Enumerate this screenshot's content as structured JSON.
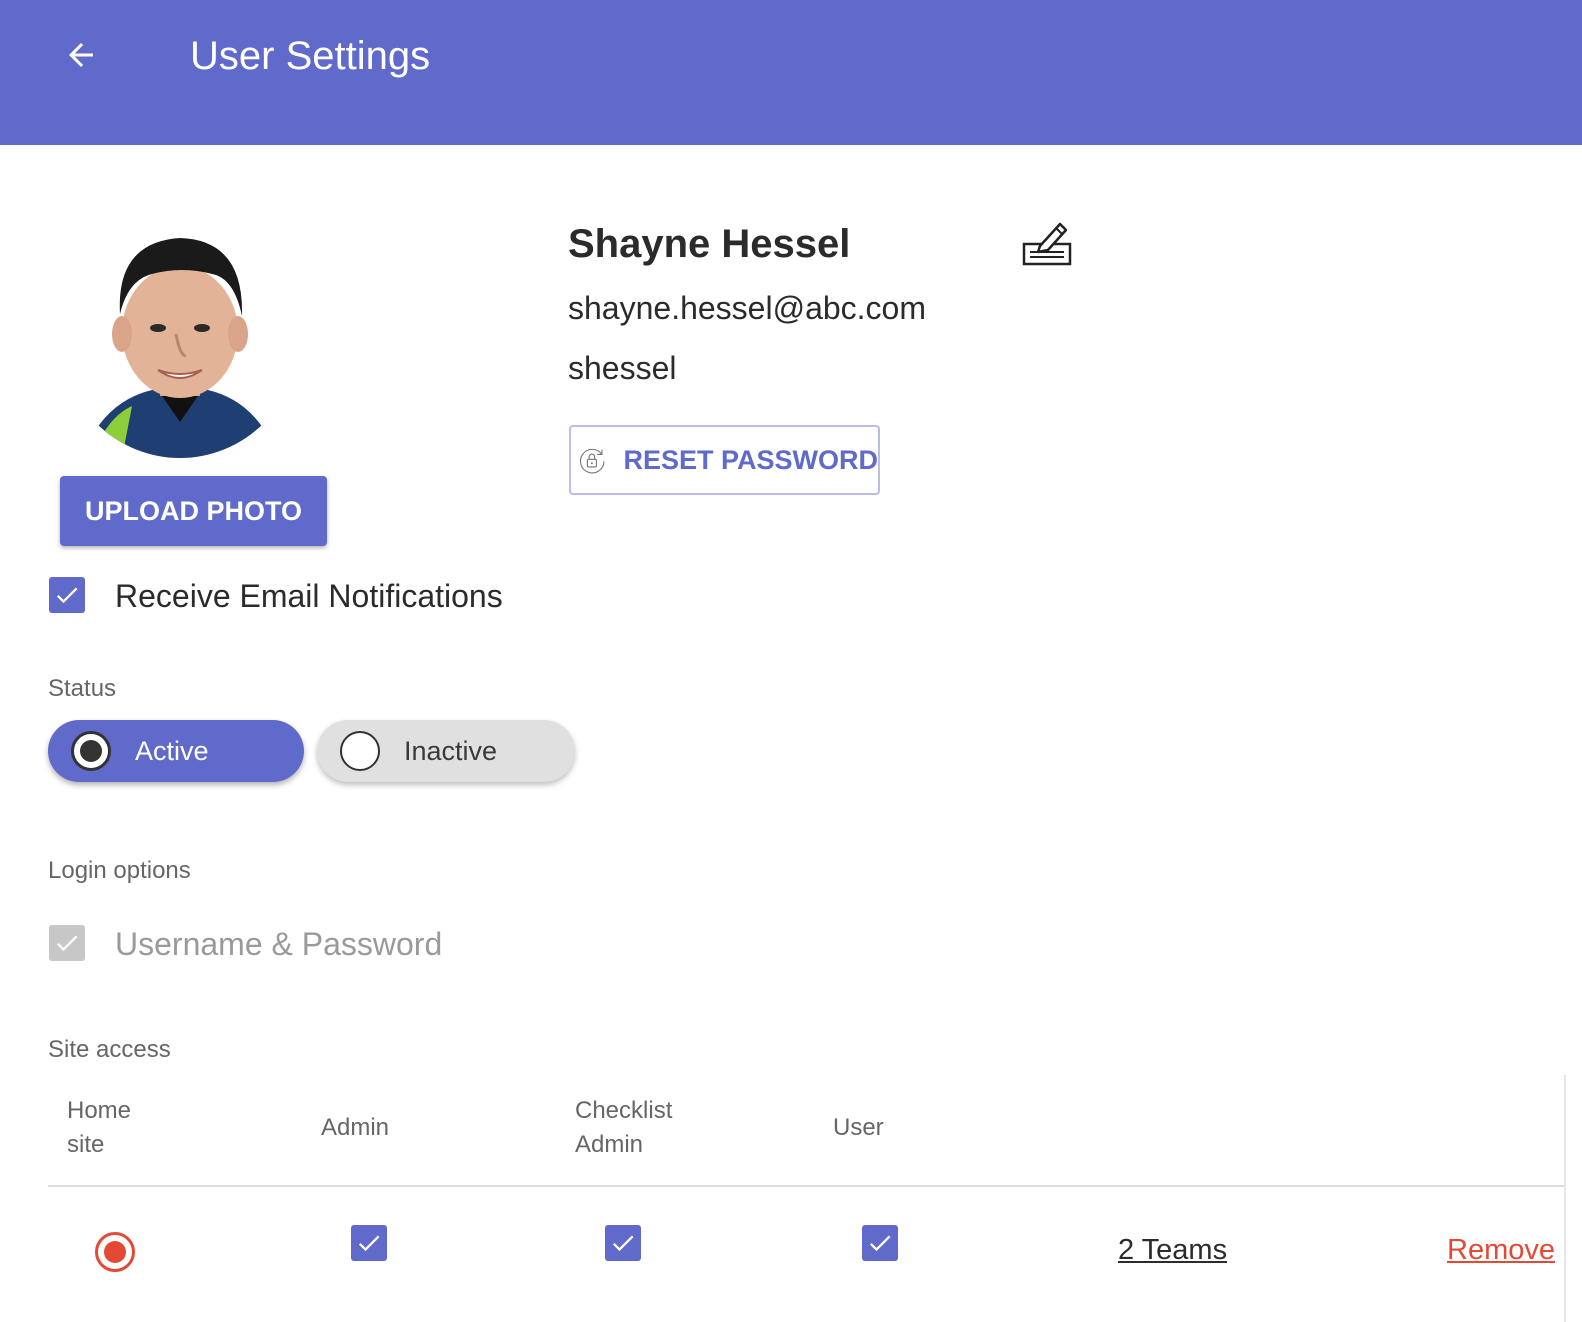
{
  "header": {
    "title": "User Settings",
    "background_color": "#5f6aca",
    "back_icon": "arrow-left-icon"
  },
  "profile": {
    "name": "Shayne Hessel",
    "email": "shayne.hessel@abc.com",
    "username": "shessel",
    "upload_photo_label": "UPLOAD PHOTO",
    "reset_password_label": "RESET PASSWORD",
    "edit_icon": "edit-signature-icon",
    "reset_icon": "lock-refresh-icon"
  },
  "notifications": {
    "label": "Receive Email Notifications",
    "checked": true
  },
  "status": {
    "label": "Status",
    "options": [
      {
        "label": "Active",
        "selected": true
      },
      {
        "label": "Inactive",
        "selected": false
      }
    ]
  },
  "login_options": {
    "label": "Login options",
    "username_password_label": "Username & Password",
    "username_password_checked": true,
    "username_password_disabled": true
  },
  "site_access": {
    "label": "Site access",
    "columns": {
      "home_site_line1": "Home",
      "home_site_line2": "site",
      "admin": "Admin",
      "checklist_admin_line1": "Checklist",
      "checklist_admin_line2": "Admin",
      "user": "User"
    },
    "rows": [
      {
        "home_site": true,
        "admin": true,
        "checklist_admin": true,
        "user": true,
        "teams_label": "2 Teams",
        "remove_label": "Remove"
      }
    ]
  },
  "colors": {
    "accent": "#5f6aca",
    "danger": "#e24a35",
    "muted_text": "#666666"
  }
}
